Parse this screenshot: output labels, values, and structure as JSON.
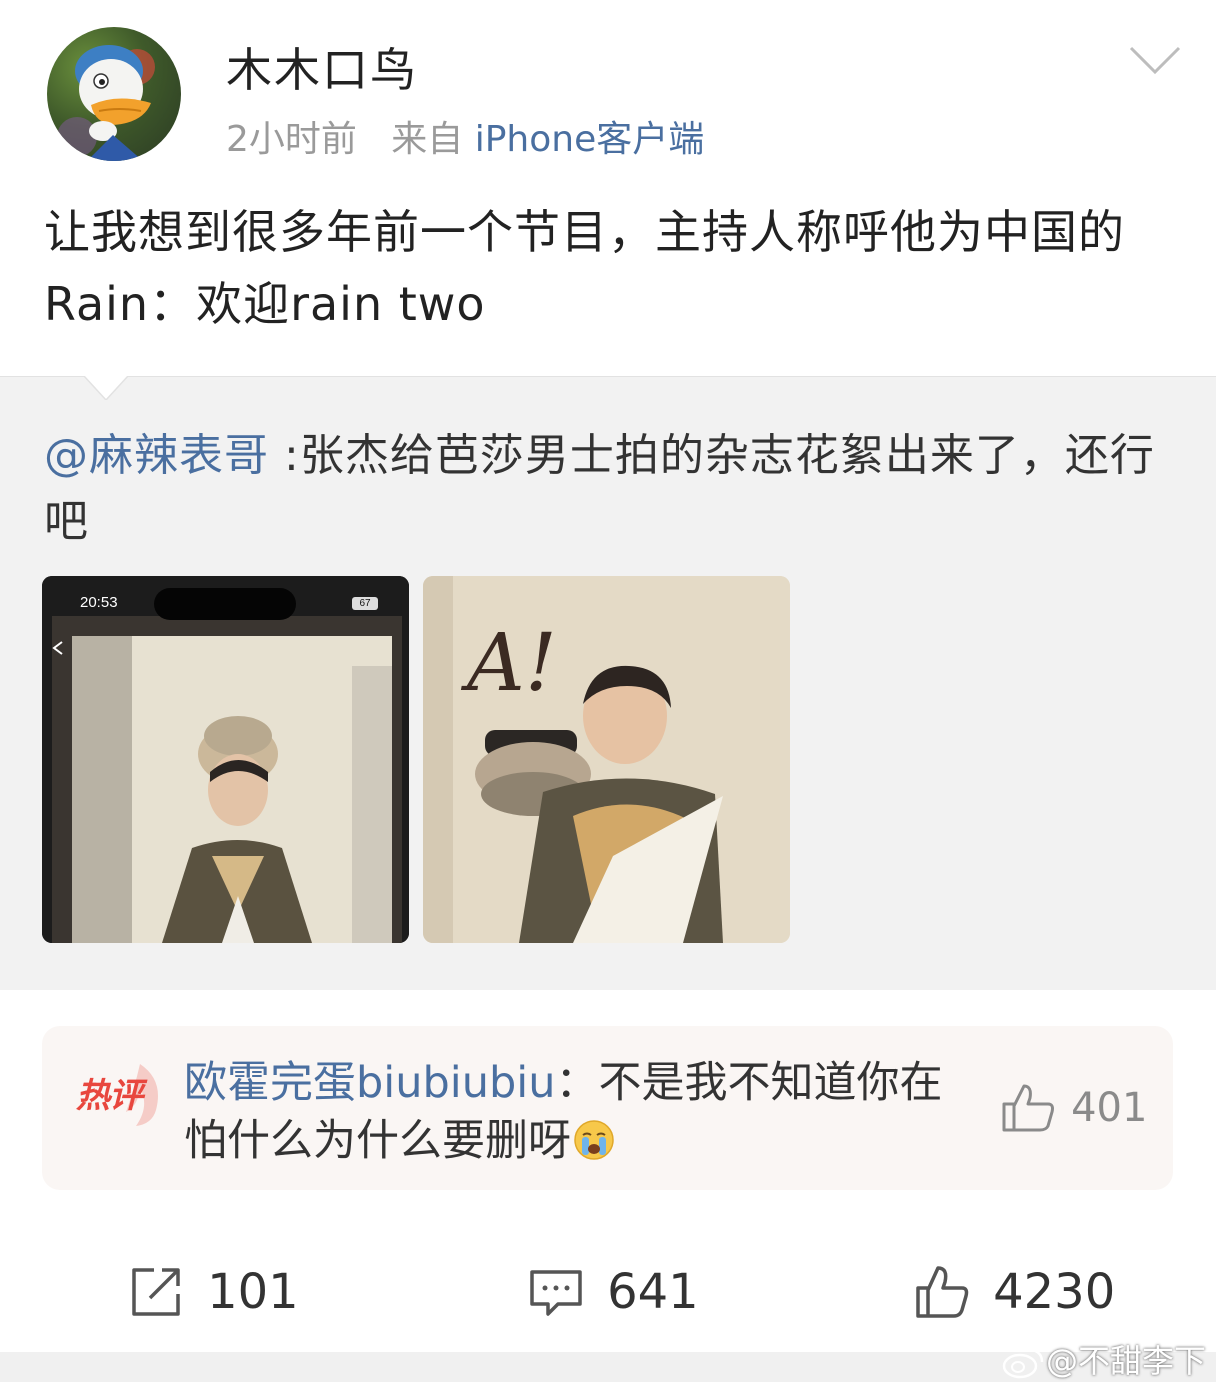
{
  "post": {
    "username": "木木口鸟",
    "time": "2小时前",
    "source_prefix": "来自",
    "source_link": "iPhone客户端",
    "text": "让我想到很多年前一个节目，主持人称呼他为中国的Rain：欢迎rain two"
  },
  "repost": {
    "mention": "@麻辣表哥",
    "text": ":张杰给芭莎男士拍的杂志花絮出来了，还行吧",
    "images": [
      {
        "status_time": "20:53",
        "battery": "67"
      },
      {
        "overlay_text": "A!"
      }
    ]
  },
  "hot_comment": {
    "tag": "热评",
    "commenter": "欧霍完蛋biubiubiu",
    "text": "：不是我不知道你在怕什么为什么要删呀",
    "emoji": "crying-face",
    "likes": "401"
  },
  "actions": {
    "reposts": "101",
    "comments": "641",
    "likes": "4230"
  },
  "watermark": "@不甜李下",
  "colors": {
    "link": "#4a6fa0",
    "hot_tag": "#e8473e",
    "repost_bg": "#f2f2f2",
    "hot_bg": "#faf6f4"
  }
}
